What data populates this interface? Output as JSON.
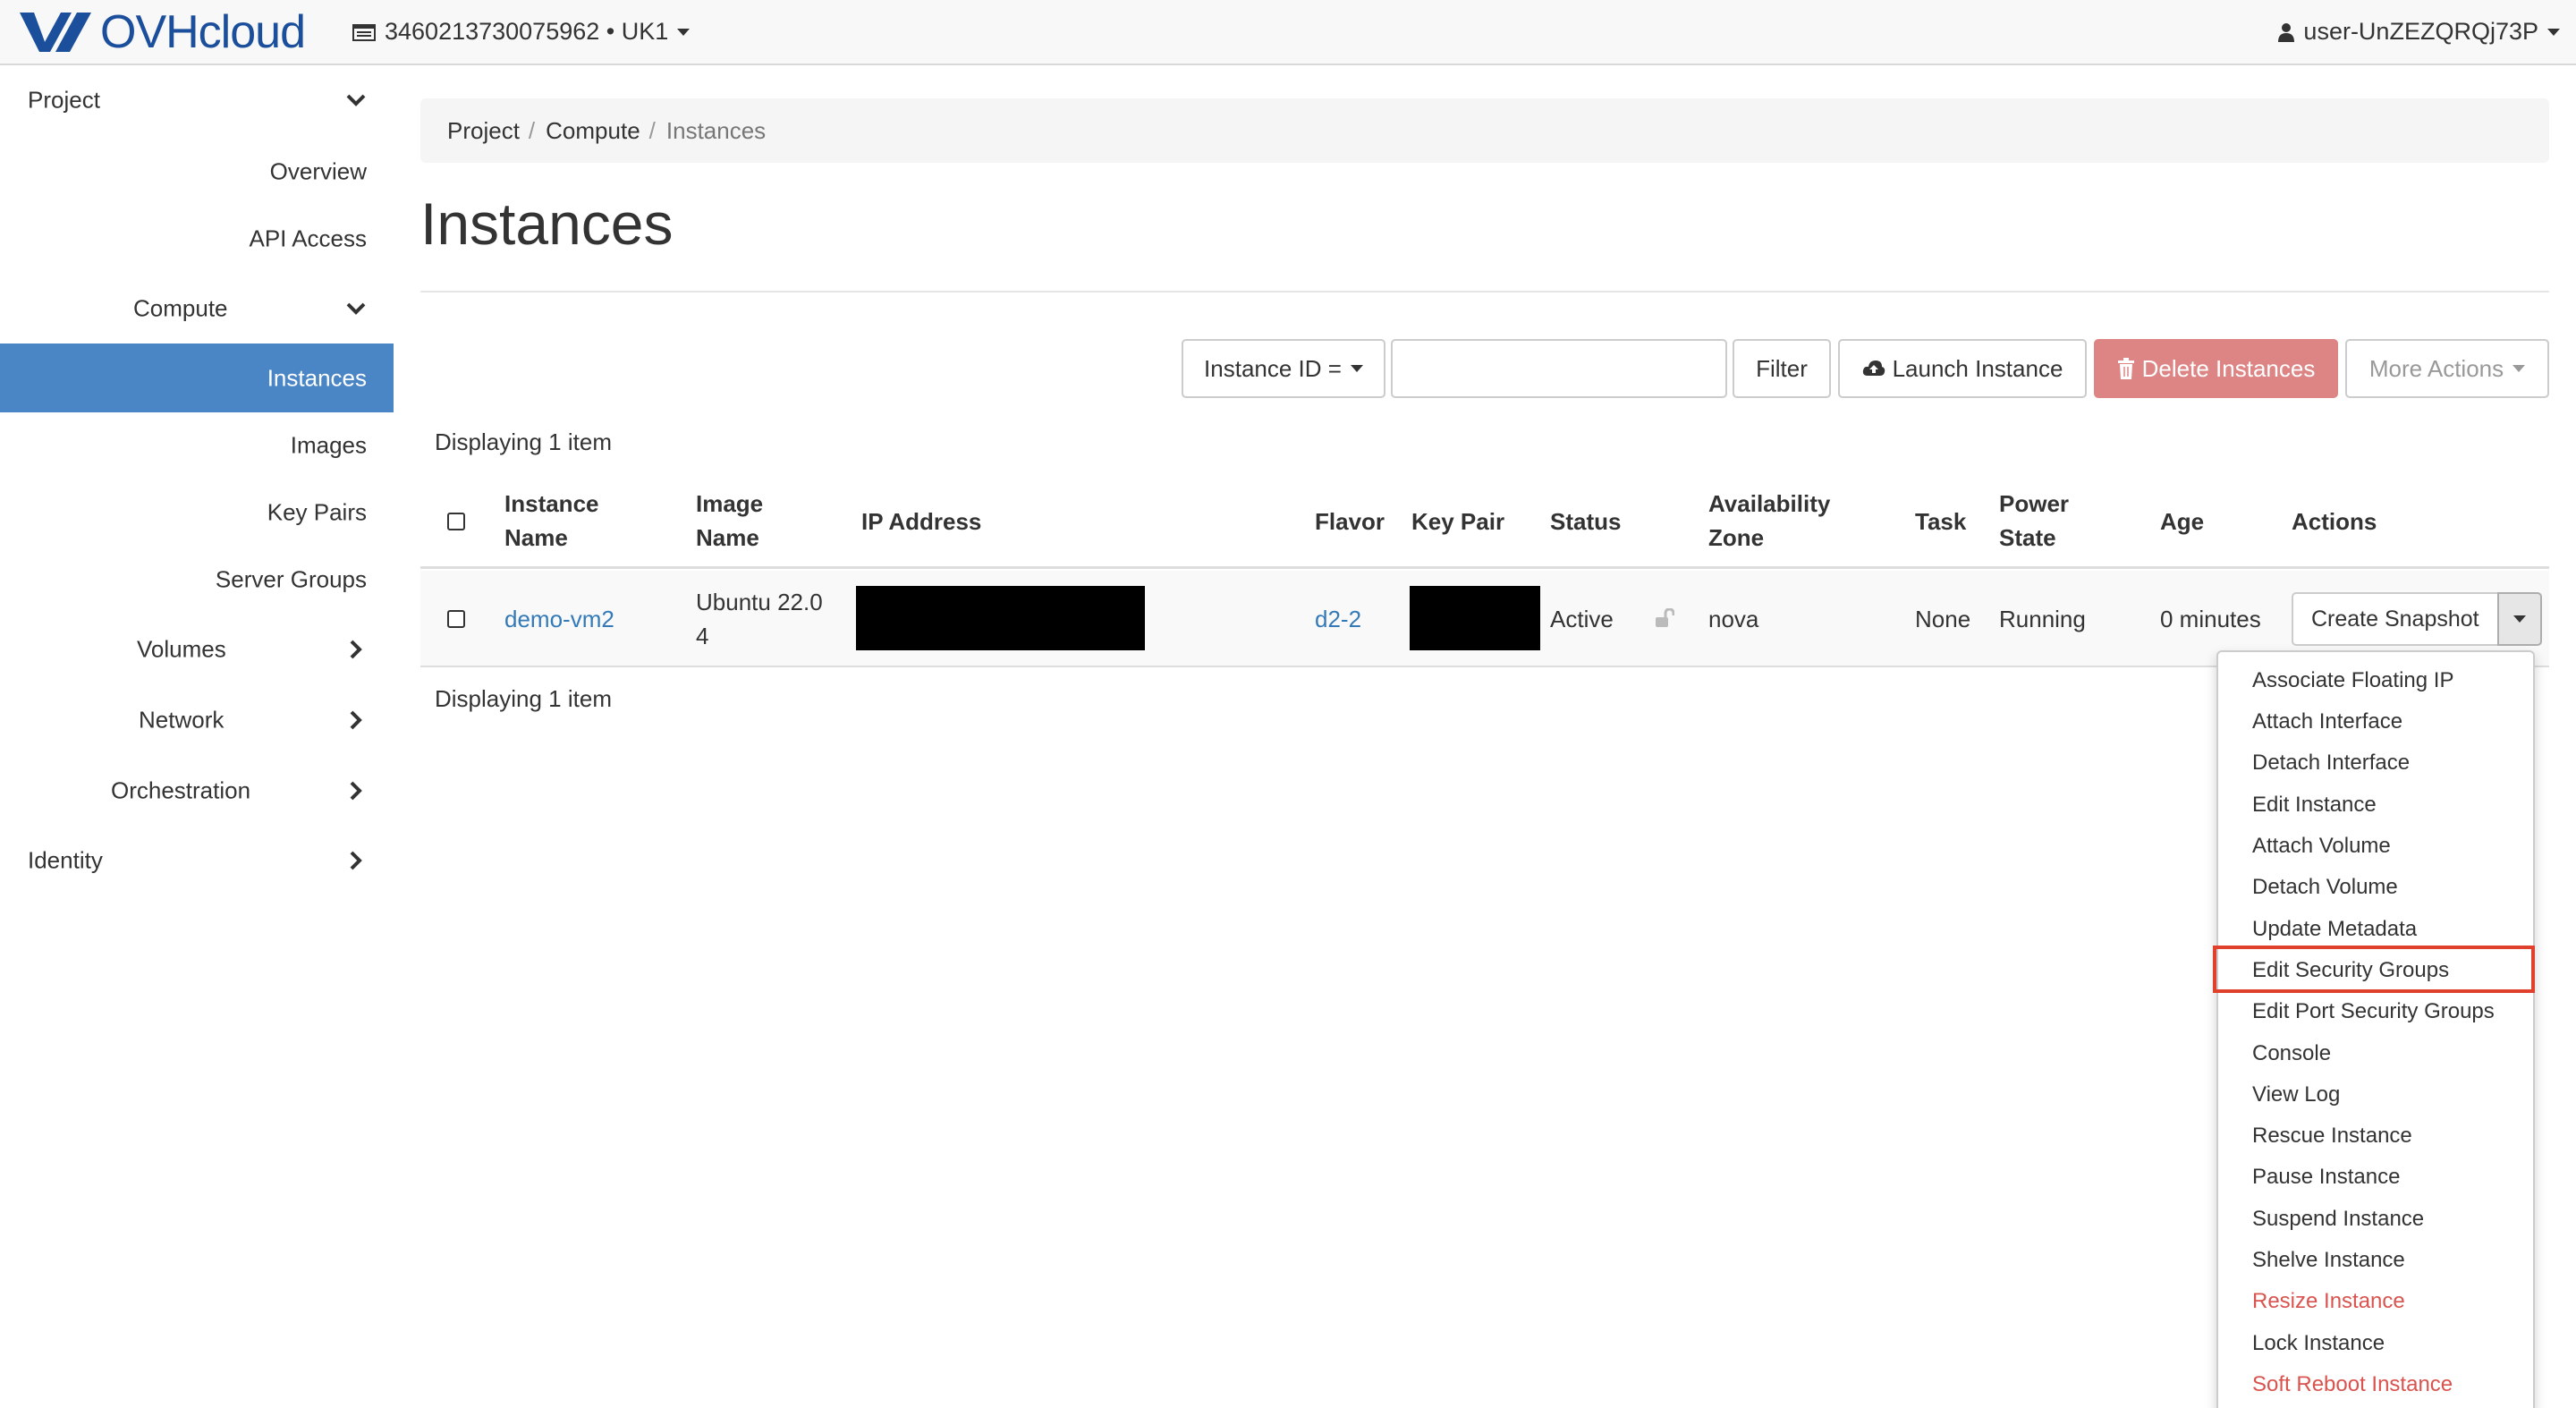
{
  "topbar": {
    "brand": "OVHcloud",
    "project_selector": "3460213730075962 • UK1",
    "user": "user-UnZEZQRQj73P"
  },
  "sidebar": {
    "items": [
      {
        "label": "Project",
        "chevron": "down"
      },
      {
        "label": "Overview"
      },
      {
        "label": "API Access"
      },
      {
        "label": "Compute",
        "chevron": "down"
      },
      {
        "label": "Instances",
        "active": true
      },
      {
        "label": "Images"
      },
      {
        "label": "Key Pairs"
      },
      {
        "label": "Server Groups"
      },
      {
        "label": "Volumes",
        "chevron": "right"
      },
      {
        "label": "Network",
        "chevron": "right"
      },
      {
        "label": "Orchestration",
        "chevron": "right"
      },
      {
        "label": "Identity",
        "chevron": "right"
      }
    ]
  },
  "breadcrumb": {
    "items": [
      "Project",
      "Compute",
      "Instances"
    ]
  },
  "page": {
    "title": "Instances"
  },
  "toolbar": {
    "filter_field": "Instance ID =",
    "filter_value": "",
    "filter_button": "Filter",
    "launch_button": "Launch Instance",
    "delete_button": "Delete Instances",
    "more_actions": "More Actions"
  },
  "table": {
    "count_top": "Displaying 1 item",
    "count_bottom": "Displaying 1 item",
    "headers": {
      "name_1": "Instance",
      "name_2": "Name",
      "image_1": "Image",
      "image_2": "Name",
      "ip": "IP Address",
      "flavor": "Flavor",
      "keypair": "Key Pair",
      "status": "Status",
      "az_1": "Availability",
      "az_2": "Zone",
      "task": "Task",
      "power_1": "Power",
      "power_2": "State",
      "age": "Age",
      "actions": "Actions"
    },
    "row": {
      "name": "demo-vm2",
      "image_1": "Ubuntu 22.0",
      "image_2": "4",
      "flavor": "d2-2",
      "status": "Active",
      "az": "nova",
      "task": "None",
      "power": "Running",
      "age": "0 minutes",
      "action_button": "Create Snapshot"
    }
  },
  "dropdown": {
    "items": [
      {
        "label": "Associate Floating IP"
      },
      {
        "label": "Attach Interface"
      },
      {
        "label": "Detach Interface"
      },
      {
        "label": "Edit Instance"
      },
      {
        "label": "Attach Volume"
      },
      {
        "label": "Detach Volume"
      },
      {
        "label": "Update Metadata"
      },
      {
        "label": "Edit Security Groups",
        "highlighted": true
      },
      {
        "label": "Edit Port Security Groups"
      },
      {
        "label": "Console"
      },
      {
        "label": "View Log"
      },
      {
        "label": "Rescue Instance"
      },
      {
        "label": "Pause Instance"
      },
      {
        "label": "Suspend Instance"
      },
      {
        "label": "Shelve Instance"
      },
      {
        "label": "Resize Instance",
        "danger": true
      },
      {
        "label": "Lock Instance"
      },
      {
        "label": "Soft Reboot Instance",
        "danger": true
      }
    ]
  },
  "colors": {
    "brand": "#1b4f9c",
    "active_nav": "#4a86c5",
    "link": "#337ab7",
    "danger_button": "#dd8585",
    "danger_text": "#d9534f",
    "highlight": "#e0412c"
  },
  "icons": {
    "project": "calendar-card-icon",
    "user": "user-icon",
    "launch": "cloud-upload-icon",
    "delete": "trash-icon",
    "lock": "unlocked-padlock-icon"
  }
}
